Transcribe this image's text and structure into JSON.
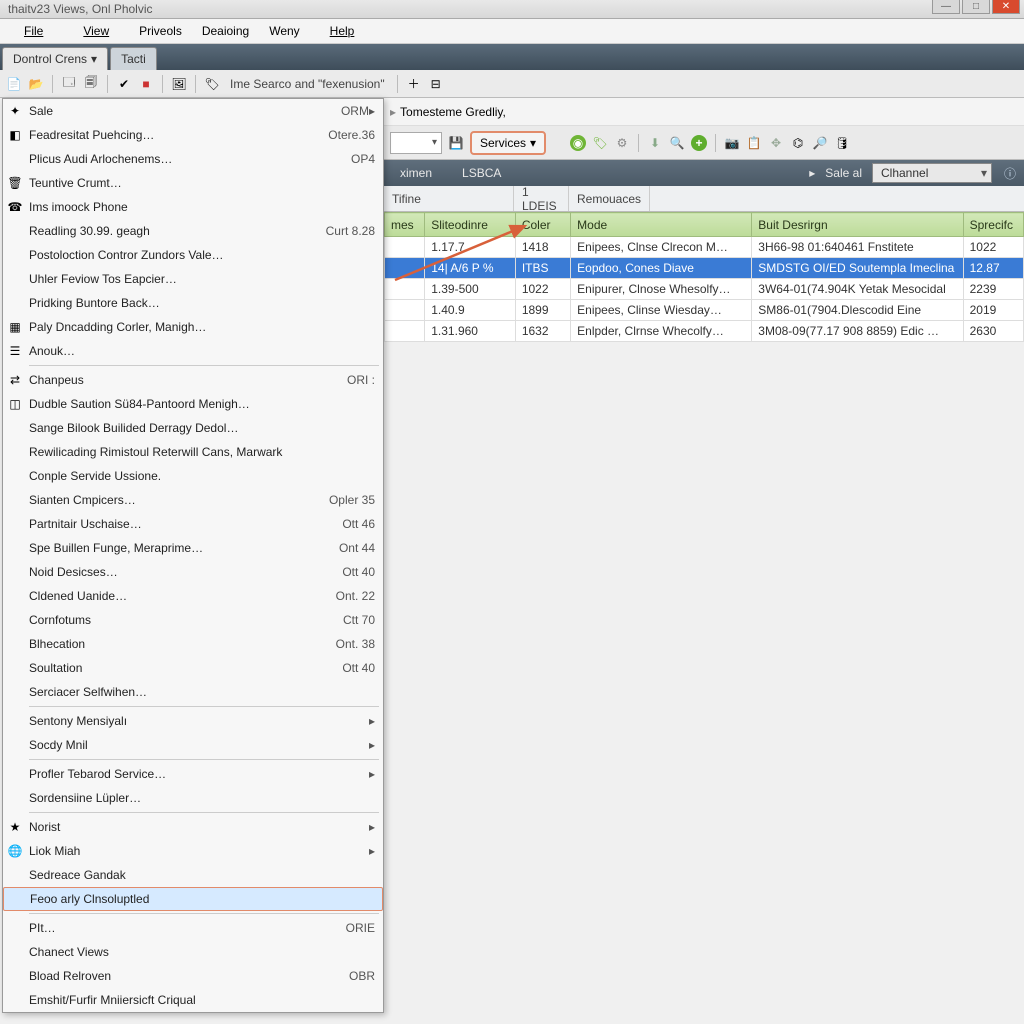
{
  "window_title": "thaitv23 Views, Onl Pholvic",
  "menubar": [
    "File",
    "View",
    "Priveols",
    "Deaioing",
    "Weny",
    "Help"
  ],
  "tabs": [
    {
      "label": "Dontrol Crens",
      "active": true,
      "has_dropdown": true
    },
    {
      "label": "Tacti",
      "active": false
    }
  ],
  "toolbar_text": "Ime Searco and \"fexenusion\"",
  "breadcrumb": {
    "arrow": "▸",
    "text": "Tomesteme Gredliy,"
  },
  "services_button": "Services",
  "nav": {
    "col_a": "ximen",
    "col_b": "LSBCA",
    "sale": "Sale al",
    "channel": "Clhannel"
  },
  "hdr2": {
    "a": "Tifine",
    "b": "1 LDEIS",
    "c": "Remouaces"
  },
  "table": {
    "headers": [
      "mes",
      "Sliteodinre",
      "Coler",
      "Mode",
      "Buit Desrirgn",
      "Sprecifc"
    ],
    "rows": [
      {
        "a": "",
        "b": "1.17.7",
        "c": "1418",
        "d": "Enipees, Clnse Clrecon M…",
        "e": "3H66-98 01:640461 Fnstitete",
        "f": "1022"
      },
      {
        "a": "",
        "b": "14| A/6 P %",
        "c": "ITBS",
        "d": "Eopdoo, Cones Diave",
        "e": "SMDSTG OI/ED Soutempla Imeclina",
        "f": "12.87",
        "sel": true
      },
      {
        "a": "",
        "b": "1.39-500",
        "c": "1022",
        "d": "Enipurer, Clnose Whesolfy…",
        "e": "3W64-01(74.904K Yetak Mesocidal",
        "f": "2239"
      },
      {
        "a": "",
        "b": "1.40.9",
        "c": "1899",
        "d": "Enipees, Clinse Wiesday…",
        "e": "SM86-01(7904.Dlescodid Eine",
        "f": "2019"
      },
      {
        "a": "",
        "b": "1.31.960",
        "c": "1632",
        "d": "Enlpder, Clrnse Whecolfy…",
        "e": "3M08-09(77.17 908 8859) Edic …",
        "f": "2630"
      }
    ]
  },
  "menu": {
    "g1": [
      {
        "icon": "sale-icon",
        "label": "Sale",
        "shortcut": "ORM",
        "arrow": true
      },
      {
        "icon": "feed-icon",
        "label": "Feadresitat Puehcing…",
        "shortcut": "Otere.36"
      },
      {
        "label": "Plicus Audi Arlochenems…",
        "shortcut": "OP4"
      },
      {
        "icon": "trash-icon",
        "label": "Teuntive Crumt…"
      },
      {
        "icon": "phone-icon",
        "label": "Ims imoock Phone"
      },
      {
        "label": "Readling 30.99. geagh",
        "shortcut": "Curt 8.28"
      },
      {
        "label": "Postoloction Contror Zundors Vale…"
      },
      {
        "label": "Uhler Feviow Tos Eapcier…"
      },
      {
        "label": "Pridking Buntore Back…"
      },
      {
        "icon": "grid-icon",
        "label": "Paly Dncadding Corler, Manigh…"
      },
      {
        "icon": "list-icon",
        "label": "Anouk…"
      }
    ],
    "g2": [
      {
        "icon": "arrows-icon",
        "label": "Chanpeus",
        "shortcut": "ORI :"
      },
      {
        "icon": "module-icon",
        "label": "Dudble Saution Sü84-Pantoord Menigh…"
      },
      {
        "label": "Sange Bilook Builided Derragy Dedol…"
      },
      {
        "label": "Rewilicading Rimistoul Reterwill Cans, Marwark"
      },
      {
        "label": "Conple Servide Ussione."
      },
      {
        "label": "Sianten Cmpicers…",
        "shortcut": "Opler 35"
      },
      {
        "label": "Partnitair Uschaise…",
        "shortcut": "Ott 46"
      },
      {
        "label": "Spe Buillen Funge, Meraprime…",
        "shortcut": "Ont 44"
      },
      {
        "label": "Noid Desicses…",
        "shortcut": "Ott 40"
      },
      {
        "label": "Cldened Uanide…",
        "shortcut": "Ont. 22"
      },
      {
        "label": "Cornfotums",
        "shortcut": "Ctt 70"
      },
      {
        "label": "Blhecation",
        "shortcut": "Ont. 38"
      },
      {
        "label": "Soultation",
        "shortcut": "Ott 40"
      },
      {
        "label": "Serciacer Selfwihen…"
      }
    ],
    "g3": [
      {
        "label": "Sentony Mensiyalı",
        "arrow": true
      },
      {
        "label": "Socdy Mnil",
        "arrow": true
      }
    ],
    "g4": [
      {
        "label": "Profler Tebarod Service…",
        "arrow": true
      },
      {
        "label": "Sordensiine Lüpler…"
      }
    ],
    "g5": [
      {
        "icon": "star-icon",
        "label": "Norist",
        "arrow": true
      },
      {
        "icon": "globe-icon",
        "label": "Liok Miah",
        "arrow": true
      },
      {
        "label": "Sedreace Gandak"
      },
      {
        "label": "Feoo arly Clnsoluptled",
        "highlighted": true
      }
    ],
    "g6": [
      {
        "label": "PIt…",
        "shortcut": "ORIE"
      },
      {
        "label": "Chanect Views"
      },
      {
        "label": "Bload Relroven",
        "shortcut": "OBR"
      },
      {
        "label": "Emshit/Furfir Mniiersicft Criqual"
      }
    ]
  }
}
